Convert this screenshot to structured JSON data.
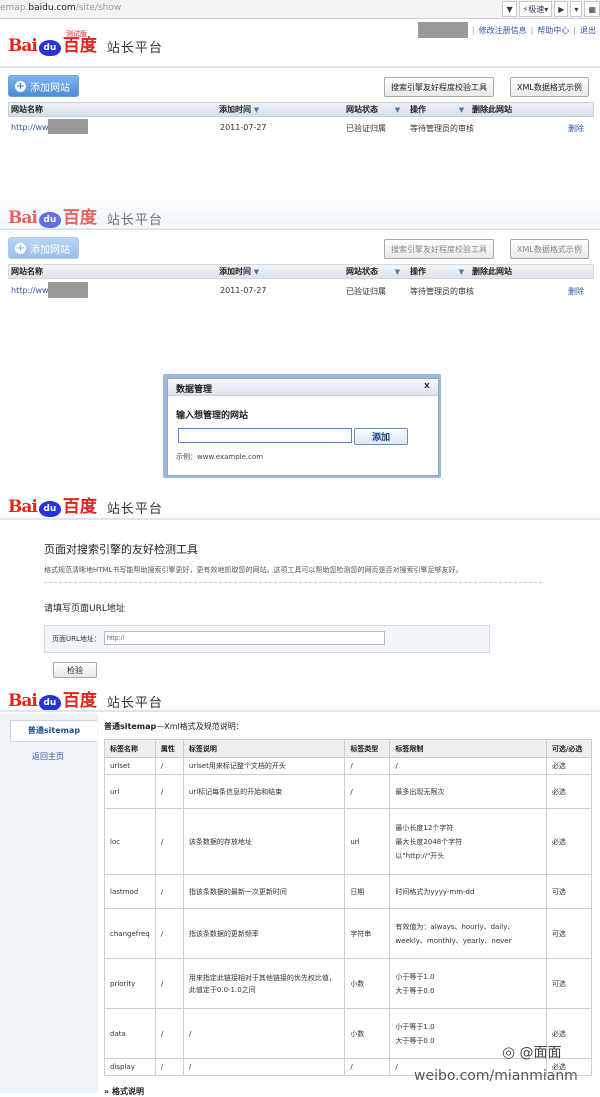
{
  "browser": {
    "url_prefix": "emap.",
    "url_host": "baidu.com",
    "url_path": "/site/show",
    "speed_label": "极速",
    "play_glyph": "▶"
  },
  "brand": {
    "logo_bai": "Bai",
    "logo_du": "du",
    "logo_baidu": "百度",
    "test_badge": "测试版",
    "platform": "站长平台"
  },
  "top_links": {
    "edit_info": "修改注册信息",
    "help": "帮助中心",
    "logout": "退出",
    "sep": "|"
  },
  "toolbar": {
    "add_site": "添加网站",
    "check_tool": "搜索引擎友好程度校验工具",
    "xml_example": "XML数据格式示例"
  },
  "site_table": {
    "headers": {
      "name": "网站名称",
      "added": "添加时间",
      "status": "网站状态",
      "operation": "操作",
      "delete": "删除此网站"
    },
    "sort_arrow": "▼",
    "row": {
      "url": "http://www.",
      "date": "2011-07-27",
      "status": "已验证归属",
      "operation": "等待管理员的审核",
      "delete": "删除"
    }
  },
  "dialog": {
    "title": "数据管理",
    "close": "x",
    "prompt": "输入想管理的网站",
    "input_value": "",
    "add_button": "添加",
    "example": "示例：www.example.com"
  },
  "check_page": {
    "title": "页面对搜索引擎的友好检测工具",
    "description": "格式规范清晰地HTML书写能帮助搜索引擎更好，更有效地抓取您的网站。这项工具可以帮助您检测您的网页是否对搜索引擎足够友好。",
    "subtitle": "请填写页面URL地址",
    "url_label": "页面URL地址：",
    "url_placeholder": "http://",
    "check_button": "检验"
  },
  "sitemap_page": {
    "side_active": "普通sitemap",
    "side_back": "返回主页",
    "heading_bold": "普通sitemap",
    "heading_rest": "—Xml格式及规范说明：",
    "columns": [
      "标签名称",
      "属性",
      "标签说明",
      "标签类型",
      "标签限制",
      "可选/必选"
    ],
    "rows": [
      {
        "name": "urlset",
        "attr": "/",
        "desc": "urlset用来标记整个文档的开头",
        "type": "/",
        "limit": [
          "/"
        ],
        "req": "必选"
      },
      {
        "name": "url",
        "attr": "/",
        "desc": "url标记每条信息的开始和结束",
        "type": "/",
        "limit": [
          "最多出现无限次"
        ],
        "req": "必选"
      },
      {
        "name": "loc",
        "attr": "/",
        "desc": "该条数据的存放地址",
        "type": "url",
        "limit": [
          "最小长度12个字符",
          "最大长度2048个字符",
          "以\"http://\"开头"
        ],
        "req": "必选"
      },
      {
        "name": "lastmod",
        "attr": "/",
        "desc": "指该条数据的最新一次更新时间",
        "type": "日期",
        "limit": [
          "时间格式为yyyy-mm-dd"
        ],
        "req": "可选"
      },
      {
        "name": "changefreq",
        "attr": "/",
        "desc": "指该条数据的更新频率",
        "type": "字符串",
        "limit": [
          "有效值为：always、hourly、daily、",
          "weekly、monthly、yearly、never"
        ],
        "req": "可选"
      },
      {
        "name": "priority",
        "attr": "/",
        "desc": "用来指定此链接相对于其他链接的优先权比值，此值定于0.0-1.0之间",
        "type": "小数",
        "limit": [
          "小于等于1.0",
          "大于等于0.0"
        ],
        "req": "可选"
      },
      {
        "name": "data",
        "attr": "/",
        "desc": "/",
        "type": "小数",
        "limit": [
          "小于等于1.0",
          "大于等于0.0"
        ],
        "req": "必选"
      },
      {
        "name": "display",
        "attr": "/",
        "desc": "/",
        "type": "/",
        "limit": [
          "/"
        ],
        "req": "必选"
      }
    ],
    "footer_hint": "格式说明"
  },
  "watermark": {
    "handle": "@面面",
    "url": "weibo.com/mianmianm"
  }
}
